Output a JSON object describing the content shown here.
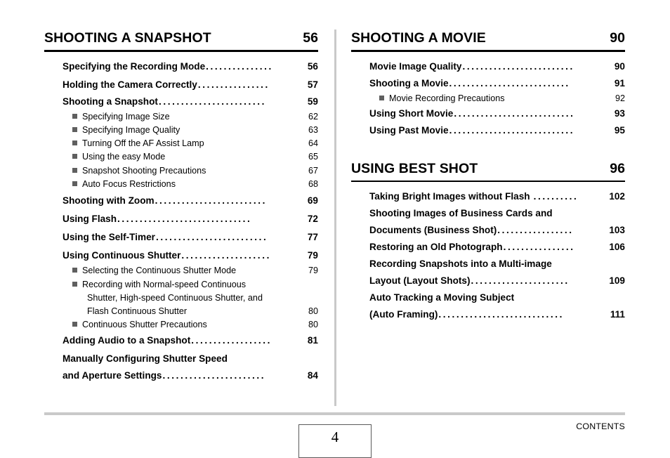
{
  "document": {
    "page_number": "4",
    "footer_label": "CONTENTS"
  },
  "columns": {
    "left": {
      "chapters": [
        {
          "title": "SHOOTING A SNAPSHOT",
          "page": "56",
          "entries": [
            {
              "type": "main",
              "label": "Specifying the Recording Mode",
              "page": "56",
              "leader": "...............",
              "gap": false
            },
            {
              "type": "main",
              "label": "Holding the Camera Correctly",
              "page": "57",
              "leader": "................",
              "gap": true
            },
            {
              "type": "main",
              "label": "Shooting a Snapshot",
              "page": "59",
              "leader": "........................",
              "gap": false
            },
            {
              "type": "sub",
              "label": "Specifying Image Size",
              "page": "62"
            },
            {
              "type": "sub",
              "label": "Specifying Image Quality",
              "page": "63"
            },
            {
              "type": "sub",
              "label": "Turning Off the AF Assist Lamp",
              "page": "64"
            },
            {
              "type": "sub",
              "label": "Using the easy Mode",
              "page": "65"
            },
            {
              "type": "sub",
              "label": "Snapshot Shooting Precautions",
              "page": "67"
            },
            {
              "type": "sub",
              "label": "Auto Focus Restrictions",
              "page": "68"
            },
            {
              "type": "main",
              "label": "Shooting with Zoom",
              "page": "69",
              "leader": ".........................",
              "gap": true
            },
            {
              "type": "main",
              "label": "Using Flash",
              "page": "72",
              "leader": "..............................",
              "gap": true
            },
            {
              "type": "main",
              "label": "Using the Self-Timer",
              "page": "77",
              "leader": ".........................",
              "gap": true
            },
            {
              "type": "main",
              "label": "Using Continuous Shutter",
              "page": "79",
              "leader": "....................",
              "gap": true
            },
            {
              "type": "sub",
              "label": "Selecting the Continuous Shutter Mode",
              "page": "79"
            },
            {
              "type": "sub-multi",
              "lines": [
                "Recording with Normal-speed Continuous",
                "Shutter, High-speed Continuous Shutter, and",
                "Flash Continuous Shutter"
              ],
              "page": "80"
            },
            {
              "type": "sub",
              "label": "Continuous Shutter Precautions",
              "page": "80"
            },
            {
              "type": "main",
              "label": "Adding Audio to a Snapshot",
              "page": "81",
              "leader": "..................",
              "gap": false
            },
            {
              "type": "main-multi",
              "lines": [
                "Manually Configuring Shutter Speed",
                "and Aperture Settings"
              ],
              "page": "84",
              "leader": ".......................",
              "gap": true
            }
          ]
        }
      ]
    },
    "right": {
      "chapters": [
        {
          "title": "SHOOTING A MOVIE",
          "page": "90",
          "entries": [
            {
              "type": "main",
              "label": "Movie Image Quality",
              "page": "90",
              "leader": ".........................",
              "gap": true
            },
            {
              "type": "main",
              "label": "Shooting a Movie",
              "page": "91",
              "leader": "...........................",
              "gap": false
            },
            {
              "type": "sub",
              "label": "Movie Recording Precautions",
              "page": "92"
            },
            {
              "type": "main",
              "label": "Using Short Movie",
              "page": "93",
              "leader": "...........................",
              "gap": false
            },
            {
              "type": "main",
              "label": "Using Past Movie",
              "page": "95",
              "leader": "............................",
              "gap": false
            }
          ]
        },
        {
          "title": "USING BEST SHOT",
          "page": "96",
          "entries": [
            {
              "type": "main",
              "label": "Taking Bright Images without Flash",
              "page": "102",
              "leader": "..........",
              "gap": true
            },
            {
              "type": "main-multi",
              "lines": [
                "Shooting Images of Business Cards and",
                "Documents (Business Shot)"
              ],
              "page": "103",
              "leader": ".................",
              "gap": false
            },
            {
              "type": "main",
              "label": "Restoring an Old Photograph",
              "page": "106",
              "leader": "................",
              "gap": false
            },
            {
              "type": "main-multi",
              "lines": [
                "Recording Snapshots into a Multi-image",
                "Layout (Layout Shots)"
              ],
              "page": "109",
              "leader": "......................",
              "gap": false
            },
            {
              "type": "main-multi",
              "lines": [
                "Auto Tracking a Moving Subject",
                "(Auto Framing)"
              ],
              "page": "111",
              "leader": "............................",
              "gap": false
            }
          ]
        }
      ]
    }
  }
}
